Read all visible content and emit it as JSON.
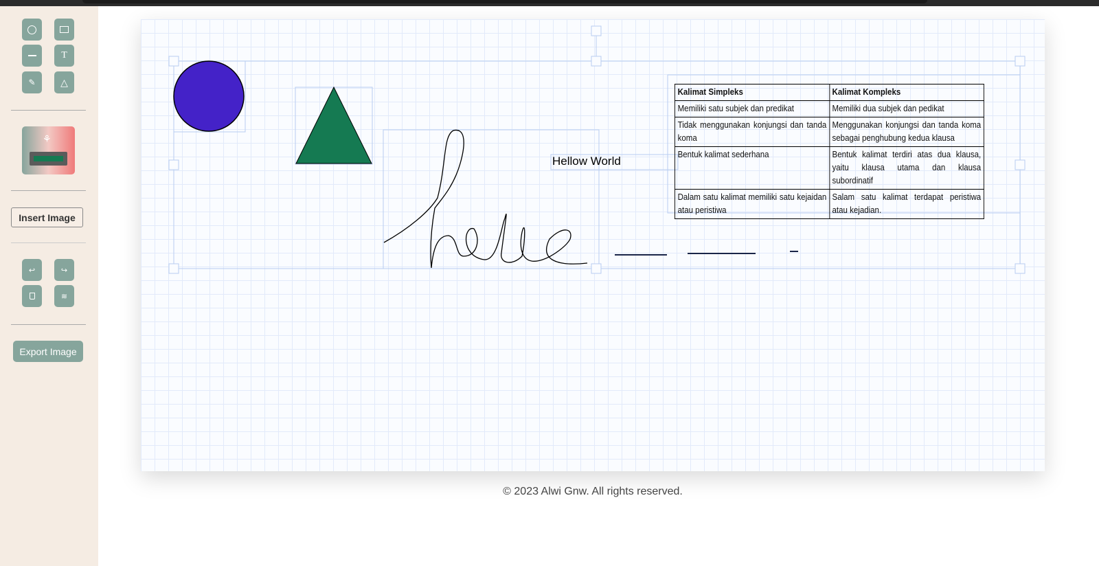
{
  "sidebar": {
    "tools": [
      "circle",
      "rectangle",
      "line",
      "text",
      "pencil",
      "triangle"
    ],
    "fill_color": "#157a52",
    "insert_image": "Insert Image",
    "actions": [
      "undo",
      "redo",
      "delete",
      "clear"
    ],
    "export_image": "Export Image"
  },
  "canvas": {
    "circle_color": "#4422c8",
    "triangle_color": "#157a52",
    "text_object": "Hellow World",
    "table": {
      "headers": [
        "Kalimat Simpleks",
        "Kalimat Kompleks"
      ],
      "rows": [
        [
          "Memiliki satu subjek dan predikat",
          "Memiliki dua subjek dan pedikat"
        ],
        [
          "Tidak menggunakan konjungsi dan tanda koma",
          "Menggunakan konjungsi dan tanda koma sebagai penghubung kedua klausa"
        ],
        [
          "Bentuk kalimat sederhana",
          "Bentuk kalimat terdiri atas dua klausa, yaitu klausa utama dan klausa subordinatif"
        ],
        [
          "Dalam satu kalimat memiliki satu kejaidan atau peristiwa",
          "Salam satu kalimat terdapat peristiwa atau kejadian."
        ]
      ]
    }
  },
  "footer": "© 2023 Alwi Gnw. All rights reserved."
}
